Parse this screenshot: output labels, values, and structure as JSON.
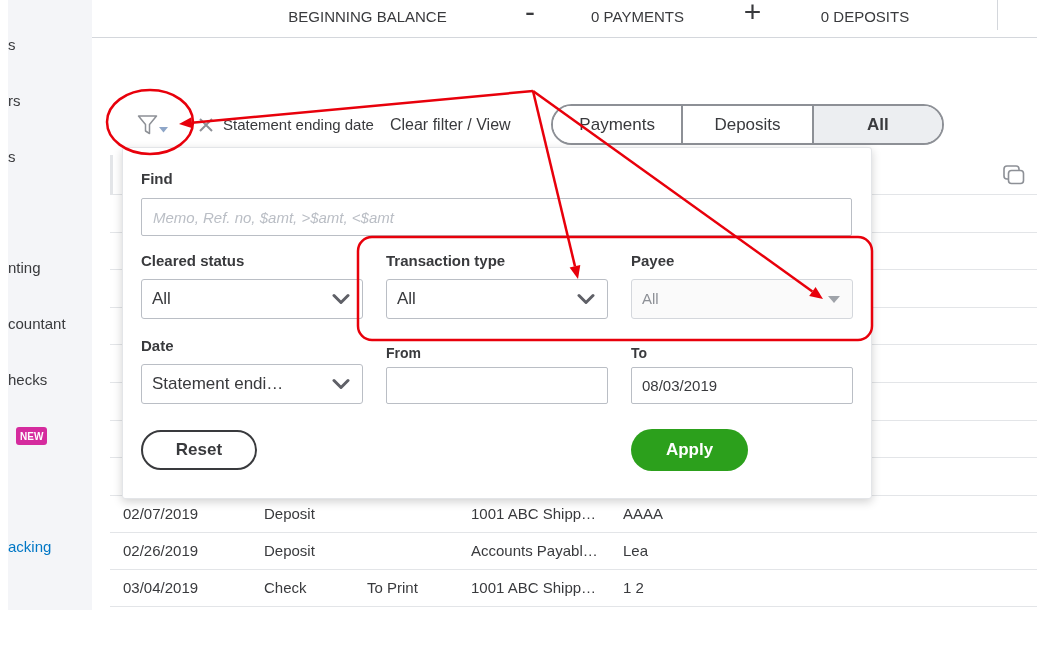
{
  "summary": [
    {
      "kind": "figure",
      "label": "BEGINNING BALANCE"
    },
    {
      "kind": "operator",
      "symbol": "-"
    },
    {
      "kind": "figure",
      "label": "0 PAYMENTS"
    },
    {
      "kind": "operator",
      "symbol": "+"
    },
    {
      "kind": "figure",
      "label": "0 DEPOSITS"
    }
  ],
  "sidebar": {
    "sections": [
      {
        "items": [
          {
            "kind": "text",
            "label": "s"
          },
          {
            "kind": "text",
            "label": "rs"
          },
          {
            "kind": "text",
            "label": "s"
          }
        ]
      },
      {
        "items": [
          {
            "kind": "text",
            "label": "nting"
          },
          {
            "kind": "text",
            "label": "countant"
          },
          {
            "kind": "text",
            "label": "hecks"
          },
          {
            "kind": "badge",
            "label": "NEW"
          }
        ]
      },
      {
        "items": [
          {
            "kind": "link",
            "label": "acking"
          }
        ]
      }
    ]
  },
  "filter_bar": {
    "active_filter": "Statement ending date",
    "clear_link": "Clear filter / View",
    "type_toggle": [
      {
        "label": "Payments",
        "selected": false
      },
      {
        "label": "Deposits",
        "selected": false
      },
      {
        "label": "All",
        "selected": true
      }
    ]
  },
  "table": {
    "rows": [
      {
        "column_1": "02/07/2019",
        "column_2": "Deposit",
        "column_4": "1001 ABC Shipp…",
        "column_5": "AAAA"
      },
      {
        "column_1": "02/26/2019",
        "column_2": "Deposit",
        "column_4": "Accounts Payabl…",
        "column_5": "Lea"
      },
      {
        "column_1": "03/04/2019",
        "column_2": "Check",
        "column_3": "To Print",
        "column_4": "1001 ABC Shipp…",
        "column_5": "1 2"
      }
    ]
  },
  "filter_panel": {
    "find": {
      "label": "Find",
      "placeholder": "Memo, Ref. no, $amt, >$amt, <$amt"
    },
    "fields": [
      {
        "kind": "select",
        "label": "Cleared status",
        "value": "All",
        "disabled": false
      },
      {
        "kind": "select",
        "label": "Transaction type",
        "value": "All",
        "disabled": false
      },
      {
        "kind": "select",
        "label": "Payee",
        "value": "All",
        "disabled": true
      },
      {
        "kind": "select",
        "label": "Date",
        "value": "Statement endi…",
        "disabled": false
      },
      {
        "kind": "input",
        "label": "From",
        "disabled": false
      },
      {
        "kind": "input",
        "label": "To",
        "value": "08/03/2019",
        "disabled": false
      }
    ],
    "buttons": [
      {
        "kind": "secondary",
        "label": "Reset"
      },
      {
        "kind": "primary",
        "label": "Apply"
      }
    ]
  }
}
